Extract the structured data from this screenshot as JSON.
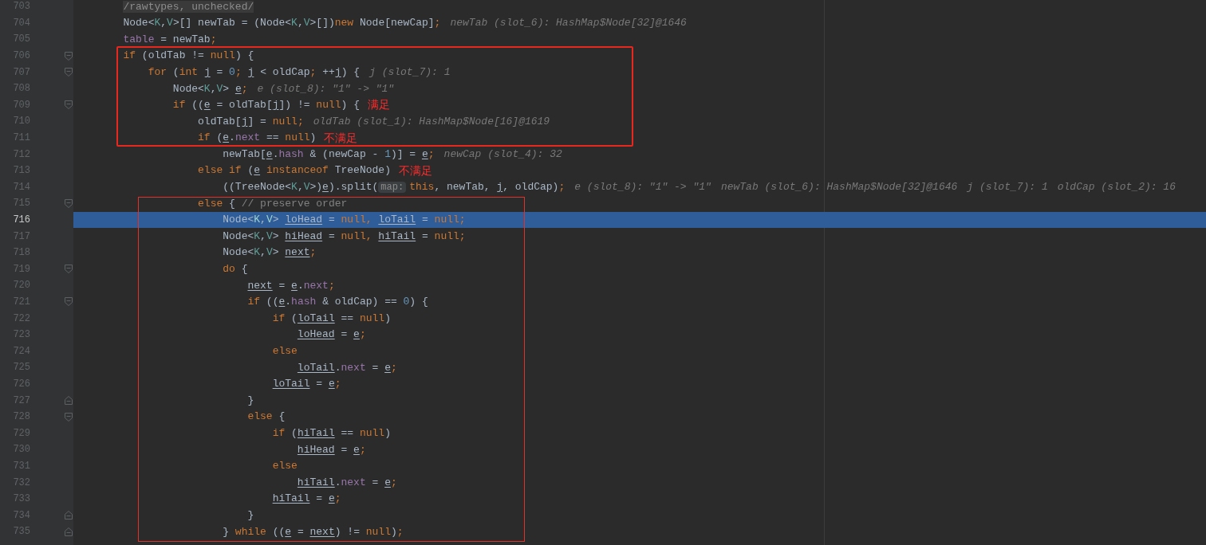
{
  "editor": {
    "blocks": [
      {
        "kind": "plain",
        "lines": [
          {
            "number": "703",
            "selected": false,
            "tokens": [
              {
                "text": "        /rawtypes, unchecked/",
                "kind": "suppressed"
              }
            ]
          },
          {
            "number": "704",
            "selected": false,
            "tokens": [
              {
                "text": "        Node<",
                "kind": "plain"
              },
              {
                "text": "K",
                "kind": "typeparam"
              },
              {
                "text": ",",
                "kind": "plain"
              },
              {
                "text": "V",
                "kind": "typeparam"
              },
              {
                "text": ">[] newTab = (Node<",
                "kind": "plain"
              },
              {
                "text": "K",
                "kind": "typeparam"
              },
              {
                "text": ",",
                "kind": "plain"
              },
              {
                "text": "V",
                "kind": "typeparam"
              },
              {
                "text": ">[])",
                "kind": "plain"
              },
              {
                "text": "new",
                "kind": "keyword"
              },
              {
                "text": " Node[newCap]",
                "kind": "plain"
              },
              {
                "text": ";",
                "kind": "keyword"
              }
            ],
            "hints": [
              "newTab (slot_6): HashMap$Node[32]@1646"
            ]
          },
          {
            "number": "705",
            "selected": false,
            "tokens": [
              {
                "text": "        table",
                "kind": "field"
              },
              {
                "text": " = newTab",
                "kind": "plain"
              },
              {
                "text": ";",
                "kind": "keyword"
              }
            ]
          }
        ]
      },
      {
        "kind": "boxed",
        "lines": [
          {
            "number": "706",
            "selected": false,
            "fold_start": true,
            "tokens": [
              {
                "text": "        if",
                "kind": "keyword"
              },
              {
                "text": " (oldTab != ",
                "kind": "plain"
              },
              {
                "text": "null",
                "kind": "keyword"
              },
              {
                "text": ") {",
                "kind": "plain"
              }
            ]
          },
          {
            "number": "707",
            "selected": false,
            "fold_start": true,
            "tokens": [
              {
                "text": "            for",
                "kind": "keyword"
              },
              {
                "text": " (",
                "kind": "plain"
              },
              {
                "text": "int",
                "kind": "keyword"
              },
              {
                "text": " j",
                "kind": "local"
              },
              {
                "text": " = ",
                "kind": "plain"
              },
              {
                "text": "0",
                "kind": "number"
              },
              {
                "text": ";",
                "kind": "keyword"
              },
              {
                "text": " j",
                "kind": "local"
              },
              {
                "text": " < oldCap",
                "kind": "plain"
              },
              {
                "text": ";",
                "kind": "keyword"
              },
              {
                "text": " ++",
                "kind": "plain"
              },
              {
                "text": "j",
                "kind": "local"
              },
              {
                "text": ") {",
                "kind": "plain"
              }
            ],
            "hints": [
              "j (slot_7): 1"
            ]
          },
          {
            "number": "708",
            "selected": false,
            "tokens": [
              {
                "text": "                Node<",
                "kind": "plain"
              },
              {
                "text": "K",
                "kind": "typeparam"
              },
              {
                "text": ",",
                "kind": "plain"
              },
              {
                "text": "V",
                "kind": "typeparam"
              },
              {
                "text": "> ",
                "kind": "plain"
              },
              {
                "text": "e",
                "kind": "local"
              },
              {
                "text": ";",
                "kind": "keyword"
              }
            ],
            "hints": [
              "e (slot_8): \"1\" -> \"1\""
            ]
          },
          {
            "number": "709",
            "selected": false,
            "fold_start": true,
            "tokens": [
              {
                "text": "                if",
                "kind": "keyword"
              },
              {
                "text": " ((",
                "kind": "plain"
              },
              {
                "text": "e",
                "kind": "local"
              },
              {
                "text": " = oldTab[",
                "kind": "plain"
              },
              {
                "text": "j",
                "kind": "local"
              },
              {
                "text": "]) != ",
                "kind": "plain"
              },
              {
                "text": "null",
                "kind": "keyword"
              },
              {
                "text": ") {",
                "kind": "plain"
              }
            ],
            "note": "满足"
          },
          {
            "number": "710",
            "selected": false,
            "tokens": [
              {
                "text": "                    oldTab[",
                "kind": "plain"
              },
              {
                "text": "j",
                "kind": "local"
              },
              {
                "text": "] = ",
                "kind": "plain"
              },
              {
                "text": "null",
                "kind": "keyword"
              },
              {
                "text": ";",
                "kind": "keyword"
              }
            ],
            "hints": [
              "oldTab (slot_1): HashMap$Node[16]@1619"
            ]
          },
          {
            "number": "711",
            "selected": false,
            "tokens": [
              {
                "text": "                    if",
                "kind": "keyword"
              },
              {
                "text": " (",
                "kind": "plain"
              },
              {
                "text": "e",
                "kind": "local"
              },
              {
                "text": ".",
                "kind": "plain"
              },
              {
                "text": "next",
                "kind": "field"
              },
              {
                "text": " == ",
                "kind": "plain"
              },
              {
                "text": "null",
                "kind": "keyword"
              },
              {
                "text": ")",
                "kind": "plain"
              }
            ],
            "note": "不满足"
          }
        ]
      },
      {
        "kind": "plain",
        "lines": [
          {
            "number": "712",
            "selected": false,
            "tokens": [
              {
                "text": "                        newTab[",
                "kind": "plain"
              },
              {
                "text": "e",
                "kind": "local"
              },
              {
                "text": ".",
                "kind": "plain"
              },
              {
                "text": "hash",
                "kind": "field"
              },
              {
                "text": " & (newCap - ",
                "kind": "plain"
              },
              {
                "text": "1",
                "kind": "number"
              },
              {
                "text": ")] = ",
                "kind": "plain"
              },
              {
                "text": "e",
                "kind": "local"
              },
              {
                "text": ";",
                "kind": "keyword"
              }
            ],
            "hints": [
              "newCap (slot_4): 32"
            ]
          },
          {
            "number": "713",
            "selected": false,
            "tokens": [
              {
                "text": "                    else if",
                "kind": "keyword"
              },
              {
                "text": " (",
                "kind": "plain"
              },
              {
                "text": "e",
                "kind": "local"
              },
              {
                "text": " instanceof",
                "kind": "keyword"
              },
              {
                "text": " TreeNode)",
                "kind": "plain"
              }
            ],
            "note": "不满足"
          },
          {
            "number": "714",
            "selected": false,
            "tokens": [
              {
                "text": "                        ((TreeNode<",
                "kind": "plain"
              },
              {
                "text": "K",
                "kind": "typeparam"
              },
              {
                "text": ",",
                "kind": "plain"
              },
              {
                "text": "V",
                "kind": "typeparam"
              },
              {
                "text": ">)",
                "kind": "plain"
              },
              {
                "text": "e",
                "kind": "local"
              },
              {
                "text": ").split(",
                "kind": "plain"
              },
              {
                "text": "map:",
                "kind": "chip"
              },
              {
                "text": "this",
                "kind": "keyword"
              },
              {
                "text": ", newTab, ",
                "kind": "plain"
              },
              {
                "text": "j",
                "kind": "local"
              },
              {
                "text": ", oldCap)",
                "kind": "plain"
              },
              {
                "text": ";",
                "kind": "keyword"
              }
            ],
            "hints": [
              "e (slot_8): \"1\" -> \"1\"",
              "newTab (slot_6): HashMap$Node[32]@1646",
              "j (slot_7): 1",
              "oldCap (slot_2): 16"
            ]
          }
        ]
      },
      {
        "kind": "outlined",
        "lines": [
          {
            "number": "715",
            "selected": false,
            "fold_start": true,
            "tokens": [
              {
                "text": "                    else",
                "kind": "keyword"
              },
              {
                "text": " { ",
                "kind": "plain"
              },
              {
                "text": "// preserve order",
                "kind": "comment"
              }
            ]
          },
          {
            "number": "716",
            "selected": true,
            "tokens": [
              {
                "text": "                        Node<",
                "kind": "plain"
              },
              {
                "text": "K",
                "kind": "typeparam"
              },
              {
                "text": ",",
                "kind": "plain"
              },
              {
                "text": "V",
                "kind": "typeparam"
              },
              {
                "text": "> ",
                "kind": "plain"
              },
              {
                "text": "loHead",
                "kind": "local"
              },
              {
                "text": " = ",
                "kind": "plain"
              },
              {
                "text": "null, ",
                "kind": "keyword"
              },
              {
                "text": "loTail",
                "kind": "local"
              },
              {
                "text": " = ",
                "kind": "plain"
              },
              {
                "text": "null;",
                "kind": "keyword"
              }
            ]
          },
          {
            "number": "717",
            "selected": false,
            "tokens": [
              {
                "text": "                        Node<",
                "kind": "plain"
              },
              {
                "text": "K",
                "kind": "typeparam"
              },
              {
                "text": ",",
                "kind": "plain"
              },
              {
                "text": "V",
                "kind": "typeparam"
              },
              {
                "text": "> ",
                "kind": "plain"
              },
              {
                "text": "hiHead",
                "kind": "local"
              },
              {
                "text": " = ",
                "kind": "plain"
              },
              {
                "text": "null, ",
                "kind": "keyword"
              },
              {
                "text": "hiTail",
                "kind": "local"
              },
              {
                "text": " = ",
                "kind": "plain"
              },
              {
                "text": "null;",
                "kind": "keyword"
              }
            ]
          },
          {
            "number": "718",
            "selected": false,
            "tokens": [
              {
                "text": "                        Node<",
                "kind": "plain"
              },
              {
                "text": "K",
                "kind": "typeparam"
              },
              {
                "text": ",",
                "kind": "plain"
              },
              {
                "text": "V",
                "kind": "typeparam"
              },
              {
                "text": "> ",
                "kind": "plain"
              },
              {
                "text": "next",
                "kind": "local"
              },
              {
                "text": ";",
                "kind": "keyword"
              }
            ]
          },
          {
            "number": "719",
            "selected": false,
            "fold_start": true,
            "tokens": [
              {
                "text": "                        do",
                "kind": "keyword"
              },
              {
                "text": " {",
                "kind": "plain"
              }
            ]
          },
          {
            "number": "720",
            "selected": false,
            "tokens": [
              {
                "text": "                            next",
                "kind": "local"
              },
              {
                "text": " = ",
                "kind": "plain"
              },
              {
                "text": "e",
                "kind": "local"
              },
              {
                "text": ".",
                "kind": "plain"
              },
              {
                "text": "next",
                "kind": "field"
              },
              {
                "text": ";",
                "kind": "keyword"
              }
            ]
          },
          {
            "number": "721",
            "selected": false,
            "fold_start": true,
            "tokens": [
              {
                "text": "                            if",
                "kind": "keyword"
              },
              {
                "text": " ((",
                "kind": "plain"
              },
              {
                "text": "e",
                "kind": "local"
              },
              {
                "text": ".",
                "kind": "plain"
              },
              {
                "text": "hash",
                "kind": "field"
              },
              {
                "text": " & oldCap) == ",
                "kind": "plain"
              },
              {
                "text": "0",
                "kind": "number"
              },
              {
                "text": ") {",
                "kind": "plain"
              }
            ]
          },
          {
            "number": "722",
            "selected": false,
            "tokens": [
              {
                "text": "                                if",
                "kind": "keyword"
              },
              {
                "text": " (",
                "kind": "plain"
              },
              {
                "text": "loTail",
                "kind": "local"
              },
              {
                "text": " == ",
                "kind": "plain"
              },
              {
                "text": "null",
                "kind": "keyword"
              },
              {
                "text": ")",
                "kind": "plain"
              }
            ]
          },
          {
            "number": "723",
            "selected": false,
            "tokens": [
              {
                "text": "                                    loHead",
                "kind": "local"
              },
              {
                "text": " = ",
                "kind": "plain"
              },
              {
                "text": "e",
                "kind": "local"
              },
              {
                "text": ";",
                "kind": "keyword"
              }
            ]
          },
          {
            "number": "724",
            "selected": false,
            "tokens": [
              {
                "text": "                                else",
                "kind": "keyword"
              }
            ]
          },
          {
            "number": "725",
            "selected": false,
            "tokens": [
              {
                "text": "                                    loTail",
                "kind": "local"
              },
              {
                "text": ".",
                "kind": "plain"
              },
              {
                "text": "next",
                "kind": "field"
              },
              {
                "text": " = ",
                "kind": "plain"
              },
              {
                "text": "e",
                "kind": "local"
              },
              {
                "text": ";",
                "kind": "keyword"
              }
            ]
          },
          {
            "number": "726",
            "selected": false,
            "tokens": [
              {
                "text": "                                loTail",
                "kind": "local"
              },
              {
                "text": " = ",
                "kind": "plain"
              },
              {
                "text": "e",
                "kind": "local"
              },
              {
                "text": ";",
                "kind": "keyword"
              }
            ]
          },
          {
            "number": "727",
            "selected": false,
            "fold_end": true,
            "tokens": [
              {
                "text": "                            }",
                "kind": "plain"
              }
            ]
          },
          {
            "number": "728",
            "selected": false,
            "fold_start": true,
            "tokens": [
              {
                "text": "                            else",
                "kind": "keyword"
              },
              {
                "text": " {",
                "kind": "plain"
              }
            ]
          },
          {
            "number": "729",
            "selected": false,
            "tokens": [
              {
                "text": "                                if",
                "kind": "keyword"
              },
              {
                "text": " (",
                "kind": "plain"
              },
              {
                "text": "hiTail",
                "kind": "local"
              },
              {
                "text": " == ",
                "kind": "plain"
              },
              {
                "text": "null",
                "kind": "keyword"
              },
              {
                "text": ")",
                "kind": "plain"
              }
            ]
          },
          {
            "number": "730",
            "selected": false,
            "tokens": [
              {
                "text": "                                    hiHead",
                "kind": "local"
              },
              {
                "text": " = ",
                "kind": "plain"
              },
              {
                "text": "e",
                "kind": "local"
              },
              {
                "text": ";",
                "kind": "keyword"
              }
            ]
          },
          {
            "number": "731",
            "selected": false,
            "tokens": [
              {
                "text": "                                else",
                "kind": "keyword"
              }
            ]
          },
          {
            "number": "732",
            "selected": false,
            "tokens": [
              {
                "text": "                                    hiTail",
                "kind": "local"
              },
              {
                "text": ".",
                "kind": "plain"
              },
              {
                "text": "next",
                "kind": "field"
              },
              {
                "text": " = ",
                "kind": "plain"
              },
              {
                "text": "e",
                "kind": "local"
              },
              {
                "text": ";",
                "kind": "keyword"
              }
            ]
          },
          {
            "number": "733",
            "selected": false,
            "tokens": [
              {
                "text": "                                hiTail",
                "kind": "local"
              },
              {
                "text": " = ",
                "kind": "plain"
              },
              {
                "text": "e",
                "kind": "local"
              },
              {
                "text": ";",
                "kind": "keyword"
              }
            ]
          },
          {
            "number": "734",
            "selected": false,
            "fold_end": true,
            "tokens": [
              {
                "text": "                            }",
                "kind": "plain"
              }
            ]
          },
          {
            "number": "735",
            "selected": false,
            "fold_end": true,
            "tokens": [
              {
                "text": "                        } ",
                "kind": "plain"
              },
              {
                "text": "while",
                "kind": "keyword"
              },
              {
                "text": " ((",
                "kind": "plain"
              },
              {
                "text": "e",
                "kind": "local"
              },
              {
                "text": " = ",
                "kind": "plain"
              },
              {
                "text": "next",
                "kind": "local"
              },
              {
                "text": ") != ",
                "kind": "plain"
              },
              {
                "text": "null",
                "kind": "keyword"
              },
              {
                "text": ")",
                "kind": "plain"
              },
              {
                "text": ";",
                "kind": "keyword"
              }
            ]
          }
        ]
      }
    ]
  }
}
